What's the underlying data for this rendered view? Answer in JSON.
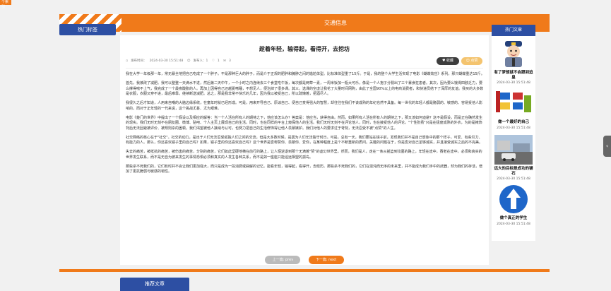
{
  "corner_badge": "个索引",
  "header": {
    "title": "交通信息",
    "left_tab": "热门标签"
  },
  "article": {
    "title": "趁着年轻，输得起，看得开，去挖坊",
    "meta": {
      "date_label": "发布时间：",
      "date": "2024-03-30 15:51:48",
      "author": "发布人：1",
      "likes": "1",
      "comments": "3"
    },
    "fav_label": "收藏",
    "like_label": "点赞",
    "paragraphs": [
      "我在大学一年级那一年，常无暴全地把自己吃成了一个胖子。不是那种巨大的胖子，而是介于正规的肥胖和臃肿之间的尴尬体型。比标准体型重了15斤。于是，我的整个大学生活实现了电影《蝴蝶效应》系列，那只蝴蝶重达15斤。",
      "首先，我被改了减肥。我可以整整一天滴水不进，然后第二天中午，一个小时之内连续去三个食堂吃午饭，每次都是两荤一素，一周米饭加一瓶大可乐，像是一个人孢子分裂出了三个暴食狂患者。其次，因为要么饿得四肢乏力，要么撑得喘不上气，我完成了一个最夜酸胀的人。再加上因得自己还越夏嗜睡，不想见人，便治掉了很多课。其三，选课的空虚让我花了大量时间网购，由此了全国90%以上的电商消费者，和快递员结下了深厚的友谊。我买的大多数是衣服，衣服又穿不进，最后难靠，继续断送减肥。总之，那是我非常不快乐的几年，因为我以被受自己，所以疏懒着，把酒尽人。",
      "我很久之后才知道，人用来自嘲的大脑边缘系统，在童年时就已经形成。可是，用来开导自己、原谅自己、便自己变得强大的智慧，却往往在我们不该成熟的年纪也然不具备。每一世代的年轻人都是脆弱的、敏感的、容易受他人影响的，而对于正年轻的一代来说，这个挑战尤甚、尤为艰难。",
      "电影《楚门的世界》中提出了一个假设以及相应的解答：当一个人活在所有人的期待之下，他应该怎么办？答案是：他应当，获得自由。然而，如果所有人活在所有人的期待之下，那又该如何迪避？这不是假设，而是正在确然发生的现实。我们无时无刻不在朋友圈、微博、贴吧、个人主页上展现自己的生活。同时，也在同样的平台上窥探他人的生活。我们无时无刻不在评论他人，同时，也在接受他人的评论。\"个性张扬\"只是在极度成熟的外衣，为的是掩饰背后无法回避被评价、被规则杀的困顿。我们渴望被他人接纳与认可，也努力把自己的生活修饰得让他人羡慕嫉妒。我们对他人的要求过于苛刻，无法忍受不被\"点赞\"的人生。",
      "社交网络的核心在于\"社交\"。社交的动力，是出于人们无法忍受孤独人们之间的交流，但是大多数时候，是因为人们无法独守时日。可是，总有一天，我们要站在镜子前，发现我们并不是自己想象中的那个样子，可爱、有些引力、有能力的人。那么，你还喜欢镜子里的自己吗？如果，镜子里的你还喜欢自己吗？这个世界是否称赞你、羡慕你、爱你，在某种程度上是个不断重新的质问。关键的问题在于，你是否对自己足够诚实，并且接受诚实之后的不完美。",
      "失去的痛苦，被抵抗的痛苦，被伤害的痛苦，分别的痛苦，它们如此坚硬地横在前行的路上，让人惬逆退到那个无满着\"赞\"的虚幻世界里。然而，我们是人，走在一条从摇篮到坟墓的路上，年轻在途中，赛老在途中。必须和真实的世界发生联系，而不是无自为彼来发生的事情恐惧必须和真实的人发生各种关系，而不是如一座座只能遥远相望的孤岛。",
      "那些杀不死我们的，它们有时并不会让我们更加强大，而只是成为一段消费或曲解的记忆。能看年轻，输得起，看得开，去经历。那些杀不死我们的，它们在混沌而无序的未来里，并不能成为我们手中的武器，却为我们的存活，增加了更抗脆弱与敏感的韧性。"
    ],
    "prev_label": "上一篇: prev",
    "next_label": "下一篇: next"
  },
  "sidebar": {
    "title": "热门文章",
    "items": [
      {
        "title": "有了梦想就不会跟到迫皇",
        "date": "2024-03-30 15:51:48",
        "icon": "police-cartoon-image"
      },
      {
        "title": "做一个最好的自己",
        "date": "2024-03-30 15:51:48",
        "icon": "traffic-sign-image"
      },
      {
        "title": "远大的目标是成功的铺石",
        "date": "2024-03-30 15:51:48",
        "icon": "road-scene-image"
      },
      {
        "title": "做个真正的学生",
        "date": "2024-03-30 15:51:48",
        "icon": "arrow-sign-image"
      }
    ]
  },
  "bottom": {
    "title": "推荐文章"
  },
  "colors": {
    "accent": "#f07a1a",
    "brand_blue": "#2d4fa3",
    "sign_blue": "#1e66c9"
  }
}
